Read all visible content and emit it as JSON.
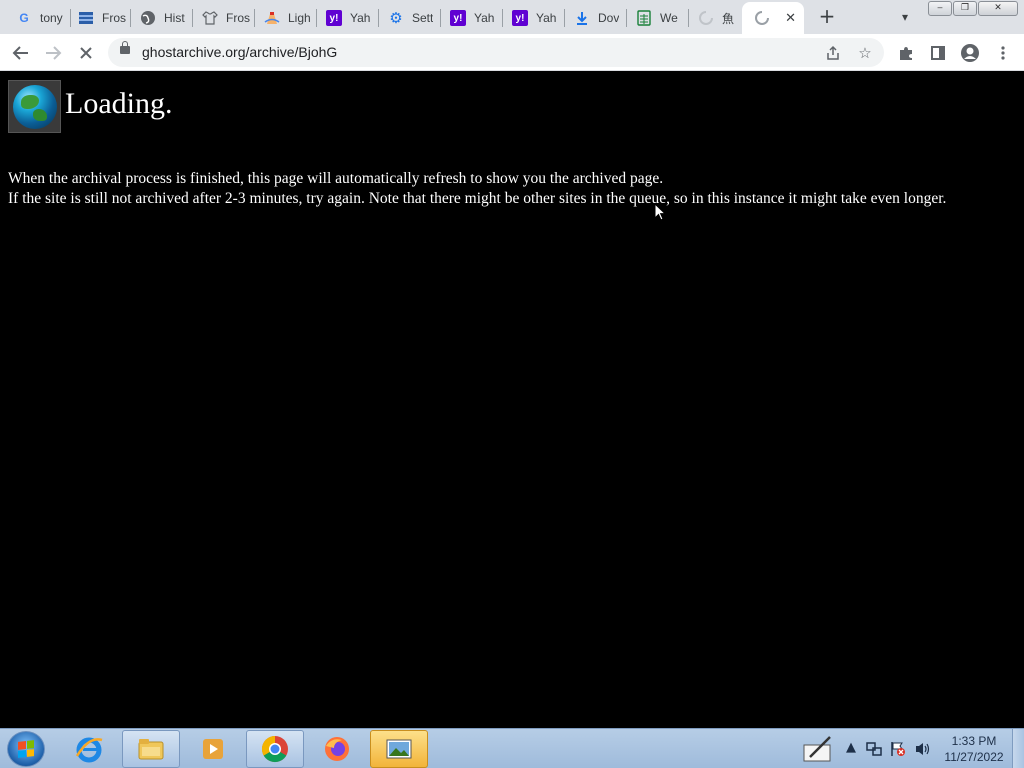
{
  "browser": {
    "tabs": [
      {
        "title": "tony",
        "icon": "google-icon",
        "color": "#4285f4"
      },
      {
        "title": "Fros",
        "icon": "flag-icon",
        "color": "#2b5ea8"
      },
      {
        "title": "Hist",
        "icon": "globe-icon",
        "color": "#5f6368"
      },
      {
        "title": "Fros",
        "icon": "shirt-icon",
        "color": "#5f6368"
      },
      {
        "title": "Ligh",
        "icon": "lighthouse-icon",
        "color": "#d93025"
      },
      {
        "title": "Yah",
        "icon": "yahoo-icon",
        "color": "#6001d2"
      },
      {
        "title": "Sett",
        "icon": "gear-icon",
        "color": "#1a73e8"
      },
      {
        "title": "Yah",
        "icon": "yahoo-icon",
        "color": "#6001d2"
      },
      {
        "title": "Yah",
        "icon": "yahoo-icon",
        "color": "#6001d2"
      },
      {
        "title": "Dov",
        "icon": "download-icon",
        "color": "#1a73e8"
      },
      {
        "title": "We",
        "icon": "spreadsheet-icon",
        "color": "#188038"
      },
      {
        "title": "魚",
        "icon": "loading-spinner-icon",
        "color": "#9aa0a6"
      },
      {
        "title": "",
        "icon": "loading-spinner-icon",
        "color": "#9aa0a6",
        "active": true
      }
    ],
    "new_tab_label": "+",
    "url": "ghostarchive.org/archive/BjohG"
  },
  "page": {
    "heading": "Loading.",
    "message_line1": "When the archival process is finished, this page will automatically refresh to show you the archived page.",
    "message_line2": "If the site is still not archived after 2-3 minutes, try again. Note that there might be other sites in the queue, so in this instance it might take even longer."
  },
  "taskbar": {
    "time": "1:33 PM",
    "date": "11/27/2022",
    "apps": [
      "internet-explorer-icon",
      "file-explorer-icon",
      "media-player-icon",
      "chrome-icon",
      "firefox-icon",
      "photo-viewer-icon"
    ]
  },
  "colors": {
    "tab_strip": "#dee1e6",
    "page_background": "#000000",
    "page_text": "#ffffff",
    "taskbar": "#b6cde6"
  }
}
